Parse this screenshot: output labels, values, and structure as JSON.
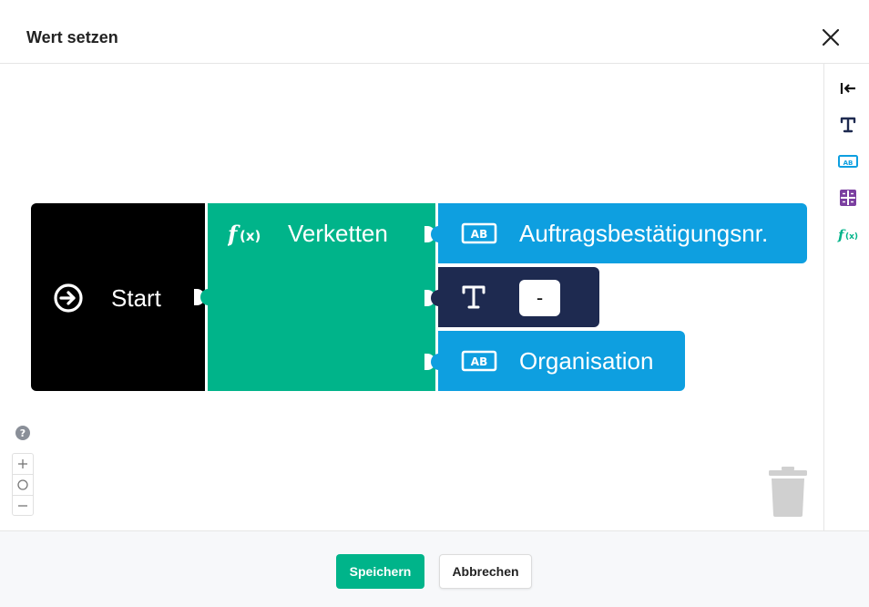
{
  "dialog": {
    "title": "Wert setzen"
  },
  "blocks": {
    "start": {
      "label": "Start",
      "color": "#000000"
    },
    "concat": {
      "label": "Verketten",
      "icon": "function-icon",
      "color": "#00b48a"
    },
    "field_auftrag": {
      "label": "Auftragsbestätigungsnr.",
      "icon": "text-field-icon",
      "color": "#0e9fe0"
    },
    "text": {
      "value": "-",
      "icon": "text-icon",
      "color": "#1e2a50"
    },
    "field_orga": {
      "label": "Organisation",
      "icon": "text-field-icon",
      "color": "#0e9fe0"
    }
  },
  "toolbox": {
    "items": [
      "collapse-icon",
      "text-icon",
      "text-field-icon",
      "grid-icon",
      "function-icon"
    ]
  },
  "footer": {
    "save_label": "Speichern",
    "cancel_label": "Abbrechen"
  },
  "colors": {
    "accent": "#00b48a",
    "field_blue": "#0e9fe0",
    "navy": "#1e2a50",
    "grid_purple": "#7b3fa0"
  }
}
